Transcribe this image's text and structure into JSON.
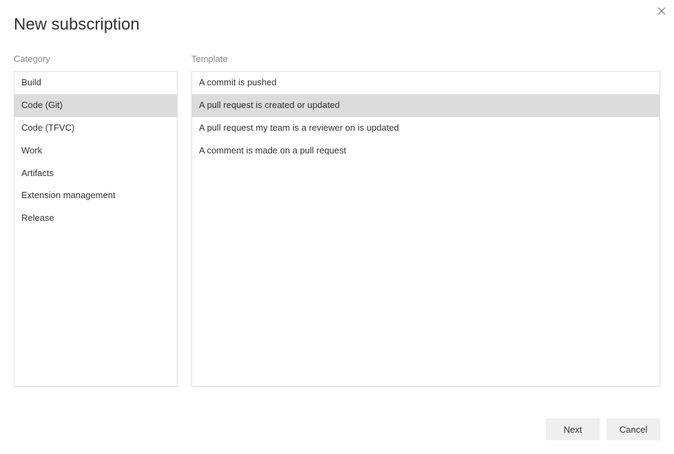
{
  "title": "New subscription",
  "labels": {
    "category": "Category",
    "template": "Template"
  },
  "categories": [
    {
      "label": "Build",
      "selected": false
    },
    {
      "label": "Code (Git)",
      "selected": true
    },
    {
      "label": "Code (TFVC)",
      "selected": false
    },
    {
      "label": "Work",
      "selected": false
    },
    {
      "label": "Artifacts",
      "selected": false
    },
    {
      "label": "Extension management",
      "selected": false
    },
    {
      "label": "Release",
      "selected": false
    }
  ],
  "templates": [
    {
      "label": "A commit is pushed",
      "selected": false
    },
    {
      "label": "A pull request is created or updated",
      "selected": true
    },
    {
      "label": "A pull request my team is a reviewer on is updated",
      "selected": false
    },
    {
      "label": "A comment is made on a pull request",
      "selected": false
    }
  ],
  "buttons": {
    "next": "Next",
    "cancel": "Cancel"
  }
}
